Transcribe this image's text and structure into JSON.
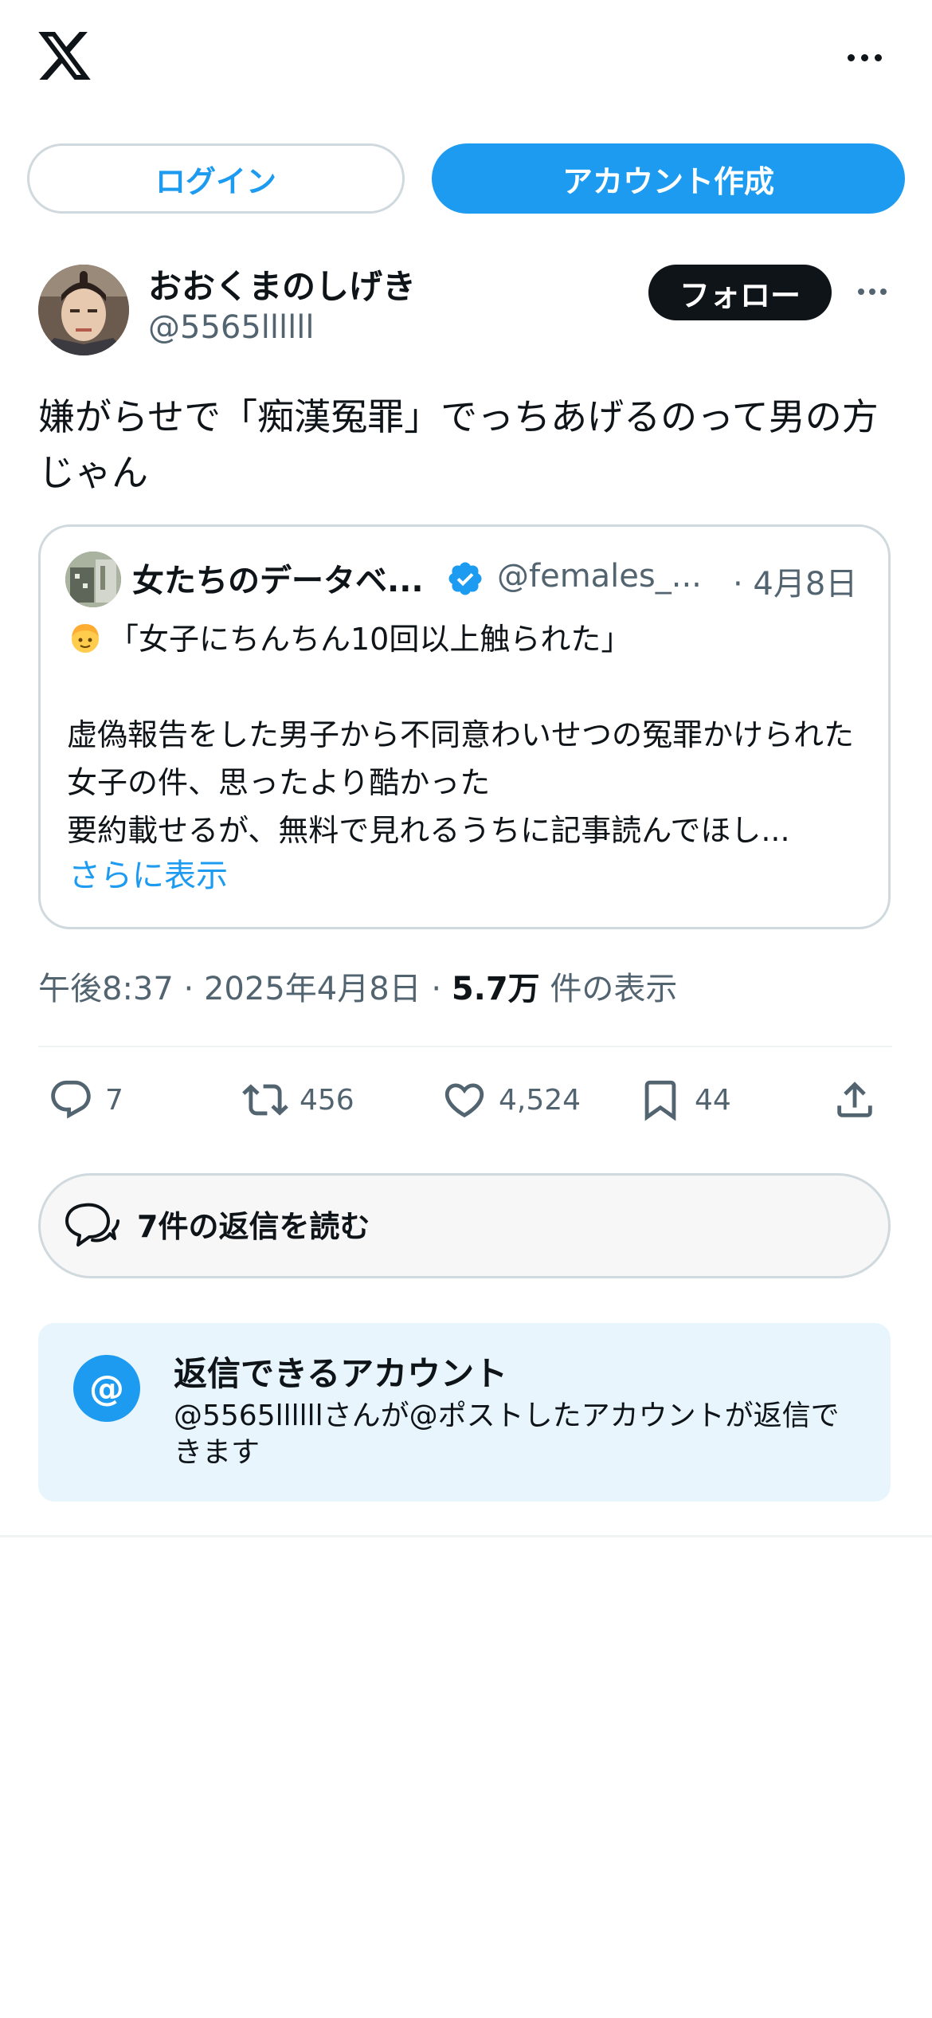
{
  "header": {
    "logo_icon": "x-logo-icon",
    "more_icon": "more-horizontal-icon"
  },
  "auth": {
    "login_label": "ログイン",
    "signup_label": "アカウント作成"
  },
  "post": {
    "author_name": "おおくまのしげき",
    "author_handle": "@5565llllll",
    "follow_label": "フォロー",
    "text": "嫌がらせで「痴漢冤罪」でっちあげるのって男の方じゃん",
    "timestamp": "午後8:37 · 2025年4月8日 · ",
    "views_count": "5.7万",
    "views_label": " 件の表示"
  },
  "quote": {
    "name": "女たちのデータベ...",
    "handle": "@females_...",
    "date": "· 4月8日",
    "emoji_icon": "boy-emoji-icon",
    "text_first_line": "「女子にちんちん10回以上触られた」",
    "text_body": "虚偽報告をした男子から不同意わいせつの冤罪かけられた女子の件、思ったより酷かった\n要約載せるが、無料で見れるうちに記事読んでほし...",
    "show_more": "さらに表示"
  },
  "actions": {
    "reply_count": "7",
    "repost_count": "456",
    "like_count": "4,524",
    "bookmark_count": "44"
  },
  "read_replies_label": "7件の返信を読む",
  "reply_restriction": {
    "title": "返信できるアカウント",
    "text": "@5565llllllさんが@ポストしたアカウントが返信できます"
  },
  "colors": {
    "accent": "#1d9bf0",
    "text": "#0f1419",
    "secondary": "#536471",
    "info_bg": "#e8f5fd"
  }
}
